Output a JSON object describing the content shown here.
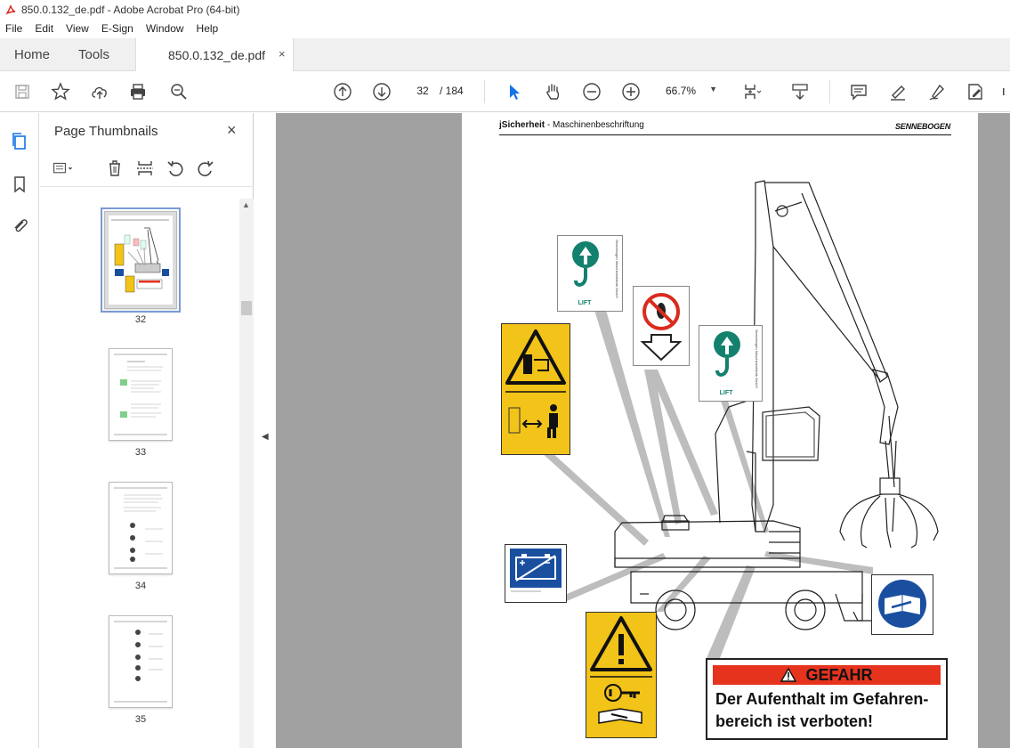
{
  "window": {
    "title": "850.0.132_de.pdf - Adobe Acrobat Pro (64-bit)"
  },
  "menu": [
    "File",
    "Edit",
    "View",
    "E-Sign",
    "Window",
    "Help"
  ],
  "tabs": {
    "home": "Home",
    "tools": "Tools",
    "document": "850.0.132_de.pdf",
    "close": "×"
  },
  "toolbar": {
    "current_page": "32",
    "total_pages": "/ 184",
    "zoom": "66.7%"
  },
  "thumbnails_panel": {
    "title": "Page Thumbnails",
    "close": "×",
    "pages": [
      "32",
      "33",
      "34",
      "35"
    ],
    "selected": "32"
  },
  "document_page": {
    "header_bold": "jSicherheit",
    "header_sep": " - ",
    "header_text": "Maschinenbeschriftung",
    "logo": "SENNEBOGEN",
    "lift_label": "LIFT",
    "lift_side": "Sennebogen Maschinenfabrik GmbH",
    "gefahr_title": "GEFAHR",
    "gefahr_line1": "Der Aufenthalt im Gefahren-",
    "gefahr_line2": "bereich ist verboten!"
  },
  "colors": {
    "accent": "#1473e6",
    "canvas": "#a1a1a1",
    "warning_yellow": "#f2c318",
    "danger_red": "#e5331d",
    "lift_green": "#14816e",
    "mandatory_blue": "#1a4fa0"
  }
}
